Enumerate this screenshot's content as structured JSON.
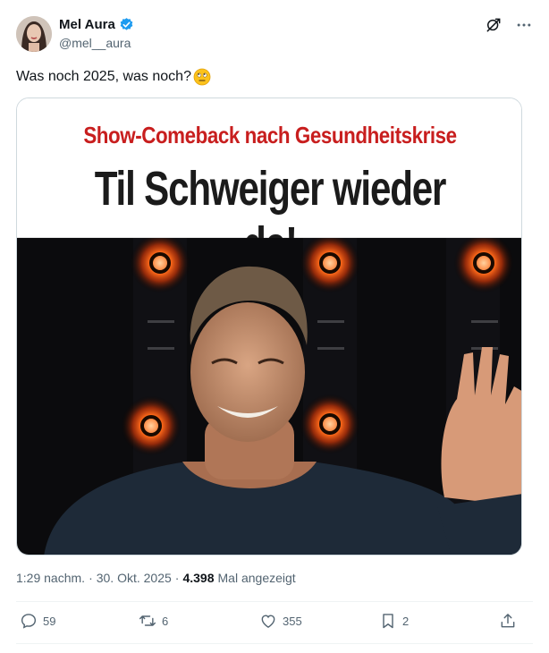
{
  "author": {
    "display_name": "Mel Aura",
    "handle": "@mel__aura"
  },
  "icons": {
    "verified": "verified-badge-icon",
    "grok": "grok-icon",
    "more": "more-icon",
    "emoji": "face-with-rolling-eyes-icon"
  },
  "tweet": {
    "text": "Was noch 2025, was noch?"
  },
  "media": {
    "kicker": "Show-Comeback nach Gesundheitskrise",
    "headline": "Til Schweiger wieder da!"
  },
  "meta": {
    "time": "1:29 nachm.",
    "sep1": "·",
    "date": "30. Okt. 2025",
    "sep2": "·",
    "views": "4.398",
    "views_label": "Mal angezeigt"
  },
  "actions": {
    "replies": "59",
    "reposts": "6",
    "likes": "355",
    "bookmarks": "2"
  },
  "colors": {
    "verified": "#1d9bf0",
    "kicker": "#c81e1e",
    "muted": "#536471"
  }
}
